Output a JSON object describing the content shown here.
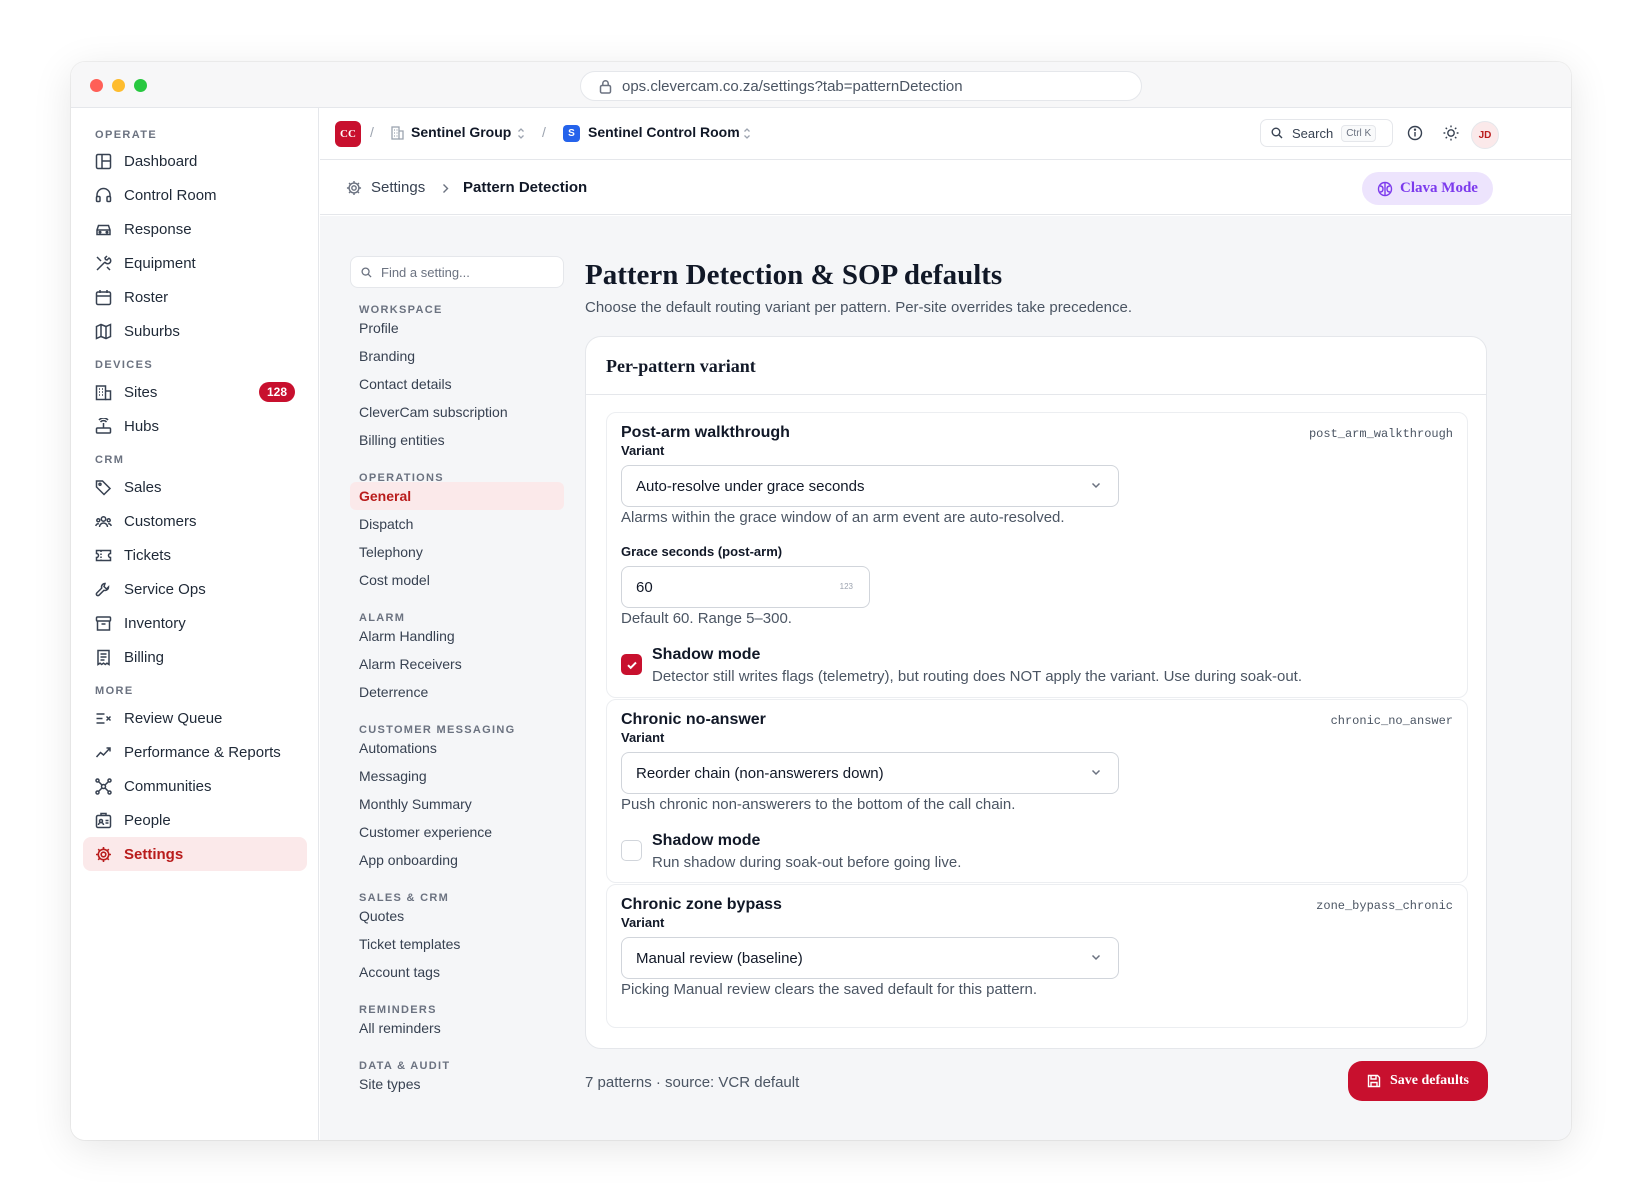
{
  "browser": {
    "url": "ops.clevercam.co.za/settings?tab=patternDetection"
  },
  "sidebar": {
    "sections": {
      "operate": "OPERATE",
      "devices": "DEVICES",
      "crm": "CRM",
      "more": "MORE"
    },
    "items": {
      "dashboard": "Dashboard",
      "control_room": "Control Room",
      "response": "Response",
      "equipment": "Equipment",
      "roster": "Roster",
      "suburbs": "Suburbs",
      "sites": "Sites",
      "sites_count": "128",
      "hubs": "Hubs",
      "sales": "Sales",
      "customers": "Customers",
      "tickets": "Tickets",
      "service_ops": "Service Ops",
      "inventory": "Inventory",
      "billing": "Billing",
      "review_queue": "Review Queue",
      "performance": "Performance & Reports",
      "communities": "Communities",
      "people": "People",
      "settings": "Settings"
    }
  },
  "topbar": {
    "org_initials": "CC",
    "group": "Sentinel Group",
    "control_room_initial": "S",
    "control_room": "Sentinel Control Room",
    "search_label": "Search",
    "search_shortcut": "Ctrl K",
    "avatar_initials": "JD"
  },
  "breadcrumb": {
    "parent": "Settings",
    "current": "Pattern Detection",
    "clava_mode": "Clava Mode"
  },
  "settings_nav": {
    "find_placeholder": "Find a setting...",
    "groups": {
      "workspace": "WORKSPACE",
      "operations": "OPERATIONS",
      "alarm": "ALARM",
      "customer_messaging": "CUSTOMER MESSAGING",
      "sales_crm": "SALES & CRM",
      "reminders": "REMINDERS",
      "data_audit": "DATA & AUDIT"
    },
    "items": {
      "profile": "Profile",
      "branding": "Branding",
      "contact_details": "Contact details",
      "subscription": "CleverCam subscription",
      "billing_entities": "Billing entities",
      "general": "General",
      "dispatch": "Dispatch",
      "telephony": "Telephony",
      "cost_model": "Cost model",
      "alarm_handling": "Alarm Handling",
      "alarm_receivers": "Alarm Receivers",
      "deterrence": "Deterrence",
      "automations": "Automations",
      "messaging": "Messaging",
      "monthly_summary": "Monthly Summary",
      "customer_experience": "Customer experience",
      "app_onboarding": "App onboarding",
      "quotes": "Quotes",
      "ticket_templates": "Ticket templates",
      "account_tags": "Account tags",
      "all_reminders": "All reminders",
      "site_types": "Site types"
    }
  },
  "main": {
    "title": "Pattern Detection & SOP defaults",
    "subtitle": "Choose the default routing variant per pattern. Per-site overrides take precedence.",
    "card_title": "Per-pattern variant",
    "variant_label": "Variant",
    "patterns": [
      {
        "name": "Post-arm walkthrough",
        "key": "post_arm_walkthrough",
        "variant": "Auto-resolve under grace seconds",
        "help": "Alarms within the grace window of an arm event are auto-resolved.",
        "grace_label": "Grace seconds (post-arm)",
        "grace_value": "60",
        "grace_hint": "123",
        "grace_help": "Default 60. Range 5–300.",
        "shadow_title": "Shadow mode",
        "shadow_desc": "Detector still writes flags (telemetry), but routing does NOT apply the variant. Use during soak-out."
      },
      {
        "name": "Chronic no-answer",
        "key": "chronic_no_answer",
        "variant": "Reorder chain (non-answerers down)",
        "help": "Push chronic non-answerers to the bottom of the call chain.",
        "shadow_title": "Shadow mode",
        "shadow_desc": "Run shadow during soak-out before going live."
      },
      {
        "name": "Chronic zone bypass",
        "key": "zone_bypass_chronic",
        "variant": "Manual review (baseline)",
        "help": "Picking Manual review clears the saved default for this pattern."
      }
    ],
    "footer": "7 patterns · source: VCR default",
    "save_label": "Save defaults"
  }
}
